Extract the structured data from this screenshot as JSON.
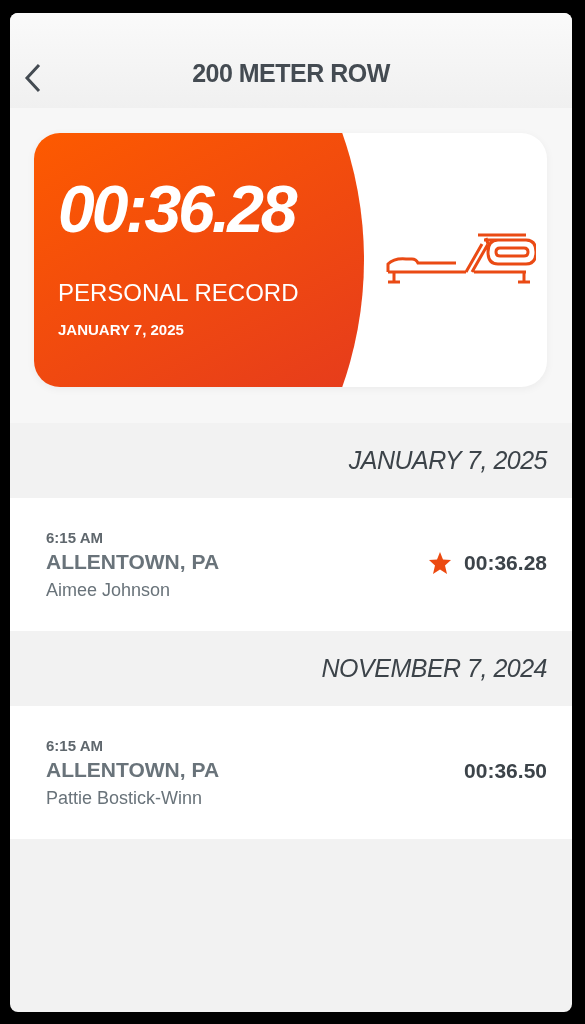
{
  "header": {
    "title": "200 METER ROW"
  },
  "record": {
    "time": "00:36.28",
    "label": "PERSONAL RECORD",
    "date": "JANUARY 7, 2025"
  },
  "sessions": [
    {
      "date": "JANUARY 7, 2025",
      "entries": [
        {
          "time": "6:15 AM",
          "location": "ALLENTOWN, PA",
          "athlete": "Aimee Johnson",
          "result": "00:36.28",
          "personal_record": true
        }
      ]
    },
    {
      "date": "NOVEMBER 7, 2024",
      "entries": [
        {
          "time": "6:15 AM",
          "location": "ALLENTOWN, PA",
          "athlete": "Pattie Bostick-Winn",
          "result": "00:36.50",
          "personal_record": false
        }
      ]
    }
  ]
}
